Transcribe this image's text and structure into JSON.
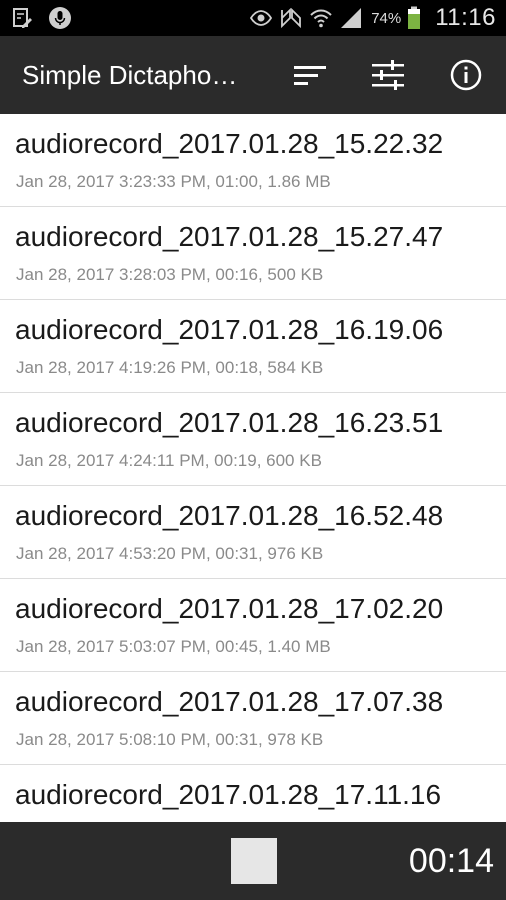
{
  "status_bar": {
    "battery": "74%",
    "time": "11:16"
  },
  "app_bar": {
    "title": "Simple Dictapho…"
  },
  "recordings": [
    {
      "name": "audiorecord_2017.01.28_15.22.32",
      "details": "Jan 28, 2017 3:23:33 PM, 01:00, 1.86 MB"
    },
    {
      "name": "audiorecord_2017.01.28_15.27.47",
      "details": "Jan 28, 2017 3:28:03 PM, 00:16, 500 KB"
    },
    {
      "name": "audiorecord_2017.01.28_16.19.06",
      "details": "Jan 28, 2017 4:19:26 PM, 00:18, 584 KB"
    },
    {
      "name": "audiorecord_2017.01.28_16.23.51",
      "details": "Jan 28, 2017 4:24:11 PM, 00:19, 600 KB"
    },
    {
      "name": "audiorecord_2017.01.28_16.52.48",
      "details": "Jan 28, 2017 4:53:20 PM, 00:31, 976 KB"
    },
    {
      "name": "audiorecord_2017.01.28_17.02.20",
      "details": "Jan 28, 2017 5:03:07 PM, 00:45, 1.40 MB"
    },
    {
      "name": "audiorecord_2017.01.28_17.07.38",
      "details": "Jan 28, 2017 5:08:10 PM, 00:31, 978 KB"
    },
    {
      "name": "audiorecord_2017.01.28_17.11.16",
      "details": ""
    }
  ],
  "bottom_bar": {
    "timer": "00:14"
  },
  "colors": {
    "app_bar": "#2b2b2b",
    "status_bar": "#000000",
    "battery_level": "#7cb342",
    "stop_button": "#e6e6e6"
  }
}
